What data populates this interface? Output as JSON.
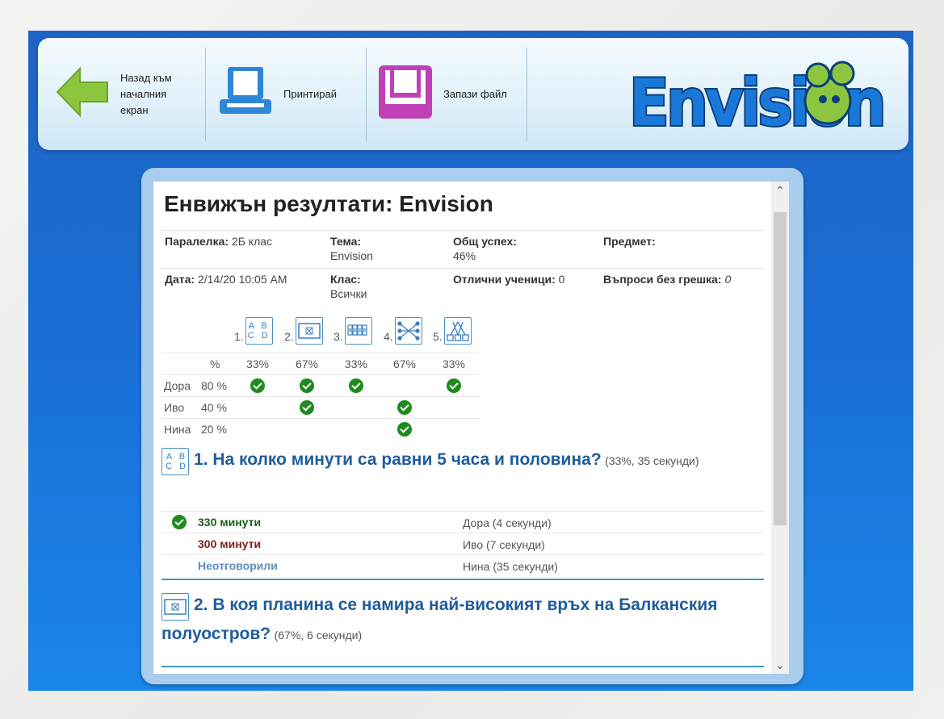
{
  "toolbar": {
    "back_label": "Назад към началния екран",
    "print_label": "Принтирай",
    "save_label": "Запази файл",
    "logo_text": "Envision",
    "colors": {
      "back_arrow": "#8cc63f",
      "print": "#2e86d6",
      "save": "#c040b8",
      "logo_blue": "#1a78d8",
      "logo_green": "#8cc63f"
    }
  },
  "report": {
    "title": "Енвижън резултати: Envision",
    "meta": {
      "class_label": "Паралелка:",
      "class_value": "2Б клас",
      "topic_label": "Тема:",
      "topic_value": "Envision",
      "success_label": "Общ успех:",
      "success_value": "46%",
      "subject_label": "Предмет:",
      "subject_value": "",
      "date_label": "Дата:",
      "date_value": "2/14/20 10:05 AM",
      "grade_label": "Клас:",
      "grade_value": "Всички",
      "excellent_label": "Отлични ученици:",
      "excellent_value": "0",
      "noerror_label": "Въпроси без грешка:",
      "noerror_value": "0"
    },
    "questions_row": [
      {
        "num": "1.",
        "icon": "abcd-icon"
      },
      {
        "num": "2.",
        "icon": "image-choice-icon"
      },
      {
        "num": "3.",
        "icon": "grid-icon"
      },
      {
        "num": "4.",
        "icon": "connect-icon"
      },
      {
        "num": "5.",
        "icon": "tree-icon"
      }
    ],
    "grid": {
      "pct_header": "%",
      "question_pcts": [
        "33%",
        "67%",
        "33%",
        "67%",
        "33%"
      ],
      "students": [
        {
          "name": "Дора",
          "pct": "80 %",
          "correct": [
            true,
            true,
            true,
            false,
            true
          ]
        },
        {
          "name": "Иво",
          "pct": "40 %",
          "correct": [
            false,
            true,
            false,
            true,
            false
          ]
        },
        {
          "name": "Нина",
          "pct": "20 %",
          "correct": [
            false,
            false,
            false,
            true,
            false
          ]
        }
      ]
    },
    "q1": {
      "title": "1. На колко минути са равни 5 часа и половина?",
      "meta": "(33%, 35 секунди)",
      "answers": [
        {
          "text": "330 минути",
          "kind": "correct",
          "students": "Дора (4 секунди)"
        },
        {
          "text": "300 минути",
          "kind": "wrong",
          "students": "Иво (7 секунди)"
        },
        {
          "text": "Неотговорили",
          "kind": "none",
          "students": "Нина (35 секунди)"
        }
      ]
    },
    "q2": {
      "title": "2. В коя планина се намира най-високият връх на Балканския полуостров?",
      "meta": "(67%, 6 секунди)"
    }
  }
}
